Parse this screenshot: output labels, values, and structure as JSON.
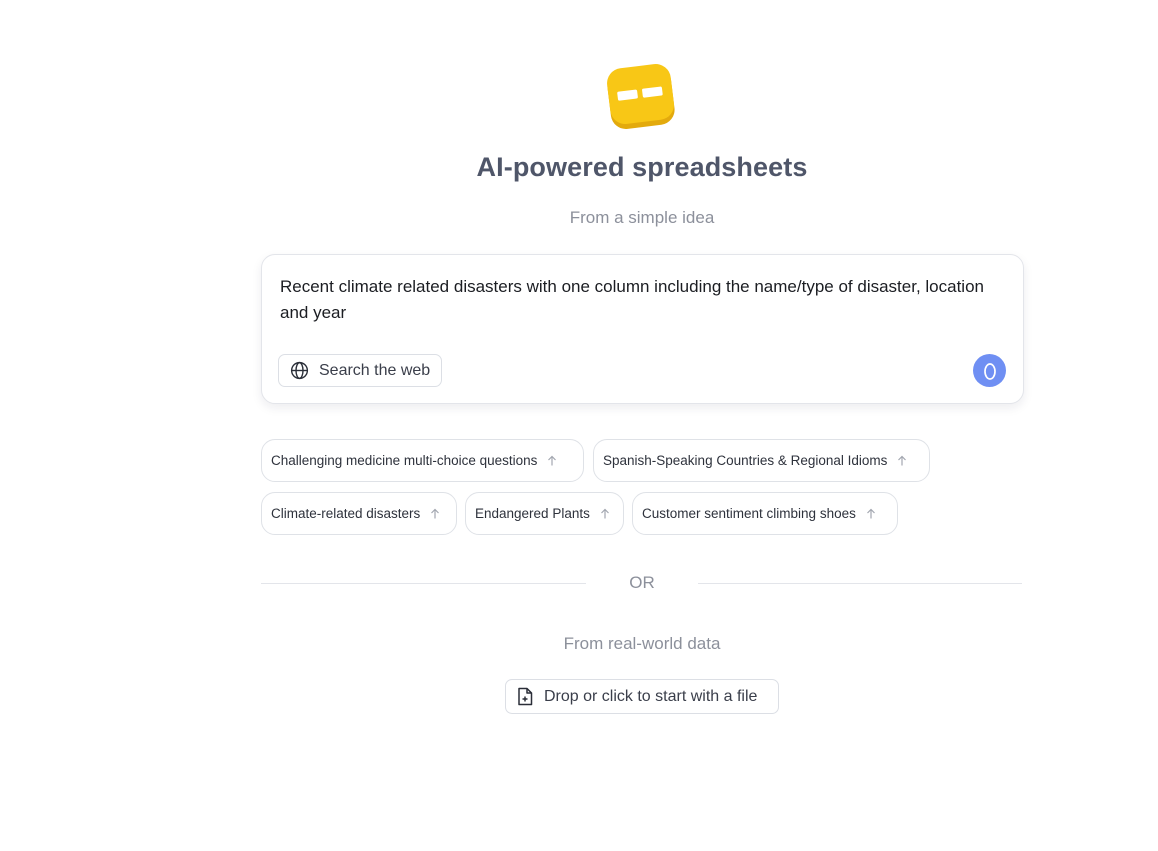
{
  "hero": {
    "logo_icon": "spreadsheet-logo-icon",
    "title": "AI-powered spreadsheets",
    "subtitle": "From a simple idea"
  },
  "prompt": {
    "value": "Recent climate related disasters with one column including the name/type of disaster, location and year",
    "search_web_label": "Search the web",
    "search_web_icon": "globe-icon",
    "send_icon": "send-icon"
  },
  "suggestions": [
    {
      "label": "Challenging medicine multi-choice questions"
    },
    {
      "label": "Spanish-Speaking Countries & Regional Idioms"
    },
    {
      "label": "Climate-related disasters"
    },
    {
      "label": "Endangered Plants"
    },
    {
      "label": "Customer sentiment climbing shoes"
    }
  ],
  "divider": {
    "label": "OR"
  },
  "data_source": {
    "title": "From real-world data",
    "button_label": "Drop or click to start with a file",
    "button_icon": "file-plus-icon"
  },
  "colors": {
    "accent": "#6f8ff3",
    "logo": "#f7c315",
    "title": "#4f5669",
    "muted": "#8c909b"
  }
}
